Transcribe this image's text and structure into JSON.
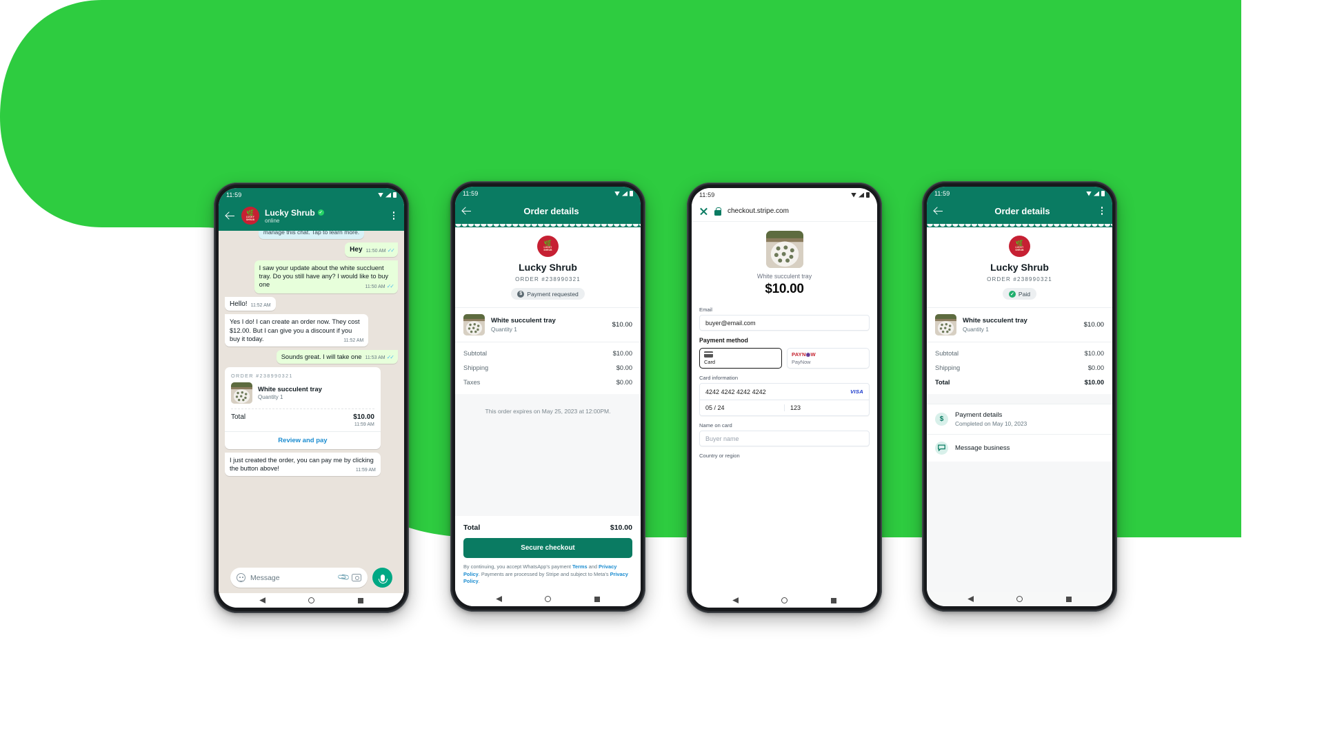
{
  "background": {
    "blob_color": "#2ecc40",
    "page_color": "#ffffff"
  },
  "brand": {
    "green": "#0a7b62",
    "whatsapp_green": "#25d366",
    "accent_blue": "#1b8cd0",
    "merchant_red": "#c62033"
  },
  "merchant": {
    "name": "Lucky Shrub",
    "logo_text": "LUCKY SHRUB"
  },
  "phone1": {
    "name": "whatsapp-chat",
    "status_time": "11:59",
    "header": {
      "name": "Lucky Shrub",
      "status": "online",
      "verified": true
    },
    "messages": [
      {
        "side": "system",
        "text": "manage this chat. Tap to learn more."
      },
      {
        "side": "out",
        "text": "Hey",
        "time": "11:50 AM",
        "ticks": "read"
      },
      {
        "side": "out",
        "text": "I saw your update about the white succluent tray. Do you still have any? I would like to buy one",
        "time": "11:50 AM",
        "ticks": "read"
      },
      {
        "side": "in",
        "text": "Hello!",
        "time": "11:52 AM"
      },
      {
        "side": "in",
        "text": "Yes I do! I can create an order now. They cost $12.00. But I can give you a discount if you buy it today.",
        "time": "11:52 AM"
      },
      {
        "side": "out",
        "text": "Sounds great. I will take one",
        "time": "11:53 AM",
        "ticks": "read"
      }
    ],
    "order_card": {
      "header": "ORDER #238990321",
      "item_name": "White succulent tray",
      "item_qty": "Quantity 1",
      "total_label": "Total",
      "total_value": "$10.00",
      "time": "11:59 AM",
      "button": "Review and pay"
    },
    "last_message": {
      "text": "I just created the order, you can pay me by clicking the button above!",
      "time": "11:59 AM"
    },
    "composer": {
      "placeholder": "Message"
    }
  },
  "phone2": {
    "name": "order-details-unpaid",
    "status_time": "11:59",
    "title": "Order details",
    "merchant_name": "Lucky Shrub",
    "order_number": "ORDER #238990321",
    "status_chip": "Payment requested",
    "status_chip_icon": "dollar-icon",
    "item": {
      "name": "White succulent tray",
      "qty": "Quantity 1",
      "price": "$10.00"
    },
    "rows": [
      {
        "label": "Subtotal",
        "value": "$10.00"
      },
      {
        "label": "Shipping",
        "value": "$0.00"
      },
      {
        "label": "Taxes",
        "value": "$0.00"
      }
    ],
    "expiry_note": "This order expires on May 25, 2023 at 12:00PM.",
    "total_label": "Total",
    "total_value": "$10.00",
    "cta": "Secure checkout",
    "legal_1": "By continuing, you accept WhatsApp's payment ",
    "legal_terms": "Terms",
    "legal_2": " and ",
    "legal_privacy": "Privacy Policy",
    "legal_3": ". Payments are processed by Stripe and subject to Meta's ",
    "legal_privacy_2": "Privacy Policy",
    "legal_4": "."
  },
  "phone3": {
    "name": "stripe-checkout",
    "status_time": "11:59",
    "url": "checkout.stripe.com",
    "product_name": "White succulent tray",
    "price": "$10.00",
    "email_label": "Email",
    "email_value": "buyer@email.com",
    "payment_method_label": "Payment method",
    "method_card": "Card",
    "method_paynow_brand": "PAYN",
    "method_paynow_o": "◉",
    "method_paynow_brand2": "W",
    "method_paynow_sub": "PayNow",
    "card_info_label": "Card information",
    "card_number": "4242 4242 4242 4242",
    "card_brand": "VISA",
    "card_expiry": "05 / 24",
    "card_cvc": "123",
    "name_on_card_label": "Name on card",
    "name_on_card_placeholder": "Buyer name",
    "country_label": "Country or region"
  },
  "phone4": {
    "name": "order-details-paid",
    "status_time": "11:59",
    "title": "Order details",
    "merchant_name": "Lucky Shrub",
    "order_number": "ORDER #238990321",
    "status_chip": "Paid",
    "status_chip_icon": "check-circle-icon",
    "item": {
      "name": "White succulent tray",
      "qty": "Quantity 1",
      "price": "$10.00"
    },
    "rows": [
      {
        "label": "Subtotal",
        "value": "$10.00"
      },
      {
        "label": "Shipping",
        "value": "$0.00"
      }
    ],
    "total_label": "Total",
    "total_value": "$10.00",
    "payment_details": {
      "title": "Payment details",
      "sub": "Completed on May 10, 2023"
    },
    "message_business": "Message business"
  }
}
